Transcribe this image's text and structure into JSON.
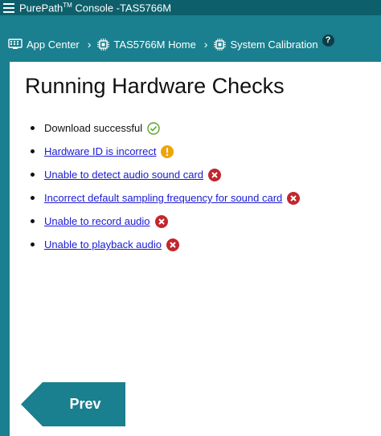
{
  "app": {
    "title_prefix": "PurePath",
    "title_tm": "TM",
    "title_suffix": " Console -TAS5766M"
  },
  "breadcrumb": {
    "items": [
      {
        "label": "App Center",
        "icon": "app-center-icon"
      },
      {
        "label": "TAS5766M Home",
        "icon": "chip-icon"
      },
      {
        "label": "System Calibration",
        "icon": "chip-icon"
      }
    ],
    "separator": "›",
    "help": "?"
  },
  "page": {
    "title": "Running Hardware Checks"
  },
  "checks": [
    {
      "label": "Download successful",
      "status": "success",
      "link": false
    },
    {
      "label": "Hardware ID is incorrect",
      "status": "warning",
      "link": true
    },
    {
      "label": "Unable to detect audio sound card",
      "status": "error",
      "link": true
    },
    {
      "label": "Incorrect default sampling frequency for sound card",
      "status": "error",
      "link": true
    },
    {
      "label": "Unable to record audio",
      "status": "error",
      "link": true
    },
    {
      "label": "Unable to playback audio",
      "status": "error",
      "link": true
    }
  ],
  "nav": {
    "prev_label": "Prev"
  },
  "colors": {
    "header": "#0d5f6b",
    "accent": "#1a7f8e",
    "success": "#5ba32b",
    "warning": "#f0a30a",
    "error": "#c1272d",
    "link": "#1a1ad6"
  }
}
